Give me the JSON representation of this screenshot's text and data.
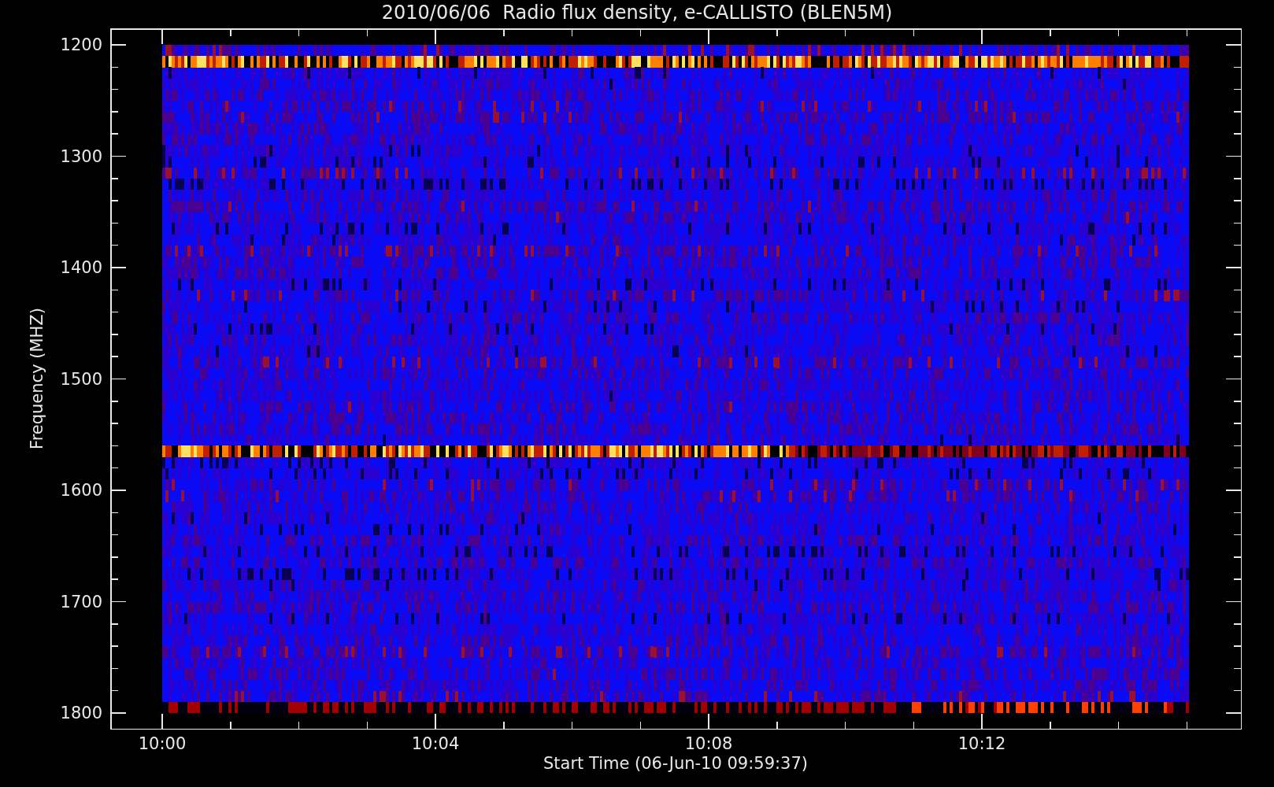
{
  "title": "2010/06/06  Radio flux density, e-CALLISTO (BLEN5M)",
  "y_axis": {
    "label": "Frequency (MHZ)",
    "ticks": [
      "1200",
      "1300",
      "1400",
      "1500",
      "1600",
      "1700",
      "1800"
    ]
  },
  "x_axis": {
    "label": "Start Time (06-Jun-10 09:59:37)",
    "ticks": [
      "10:00",
      "10:04",
      "10:08",
      "10:12"
    ]
  }
}
